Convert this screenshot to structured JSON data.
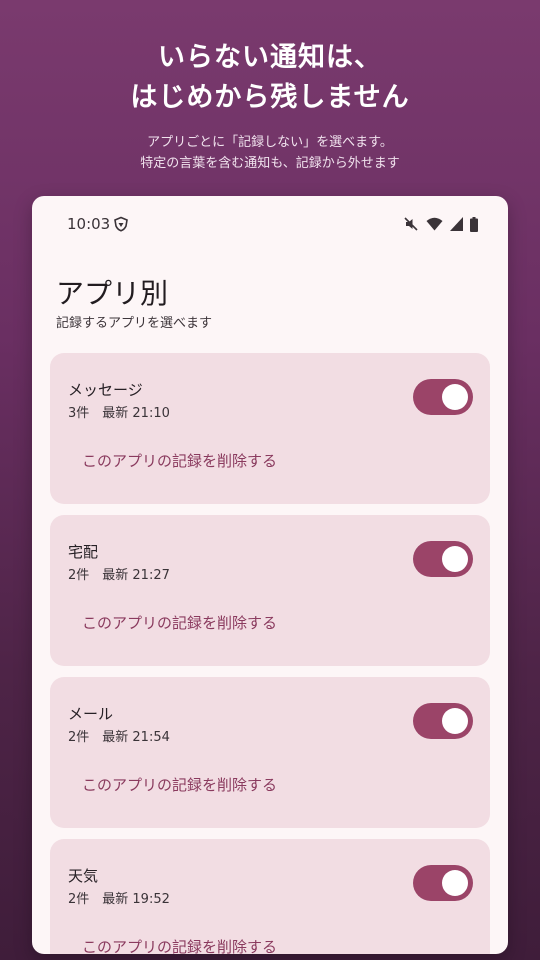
{
  "hero": {
    "title_line1": "いらない通知は、",
    "title_line2": "はじめから残しません",
    "sub_line1": "アプリごとに「記録しない」を選べます。",
    "sub_line2": "特定の言葉を含む通知も、記録から外せます"
  },
  "status_bar": {
    "time": "10:03",
    "icons": [
      "vpn-shield-icon",
      "mute-icon",
      "wifi-icon",
      "signal-icon",
      "battery-icon"
    ]
  },
  "page": {
    "title": "アプリ別",
    "subtitle": "記録するアプリを選べます"
  },
  "apps": [
    {
      "name": "メッセージ",
      "meta": "3件　最新 21:10",
      "enabled": true,
      "delete_label": "このアプリの記録を削除する"
    },
    {
      "name": "宅配",
      "meta": "2件　最新 21:27",
      "enabled": true,
      "delete_label": "このアプリの記録を削除する"
    },
    {
      "name": "メール",
      "meta": "2件　最新 21:54",
      "enabled": true,
      "delete_label": "このアプリの記録を削除する"
    },
    {
      "name": "天気",
      "meta": "2件　最新 19:52",
      "enabled": true,
      "delete_label": "このアプリの記録を削除する"
    }
  ],
  "colors": {
    "accent": "#9b4468",
    "card": "#f2dde3",
    "link": "#8a3a5e",
    "background_top": "#7a3a6e",
    "background_bottom": "#3f1d3a"
  }
}
